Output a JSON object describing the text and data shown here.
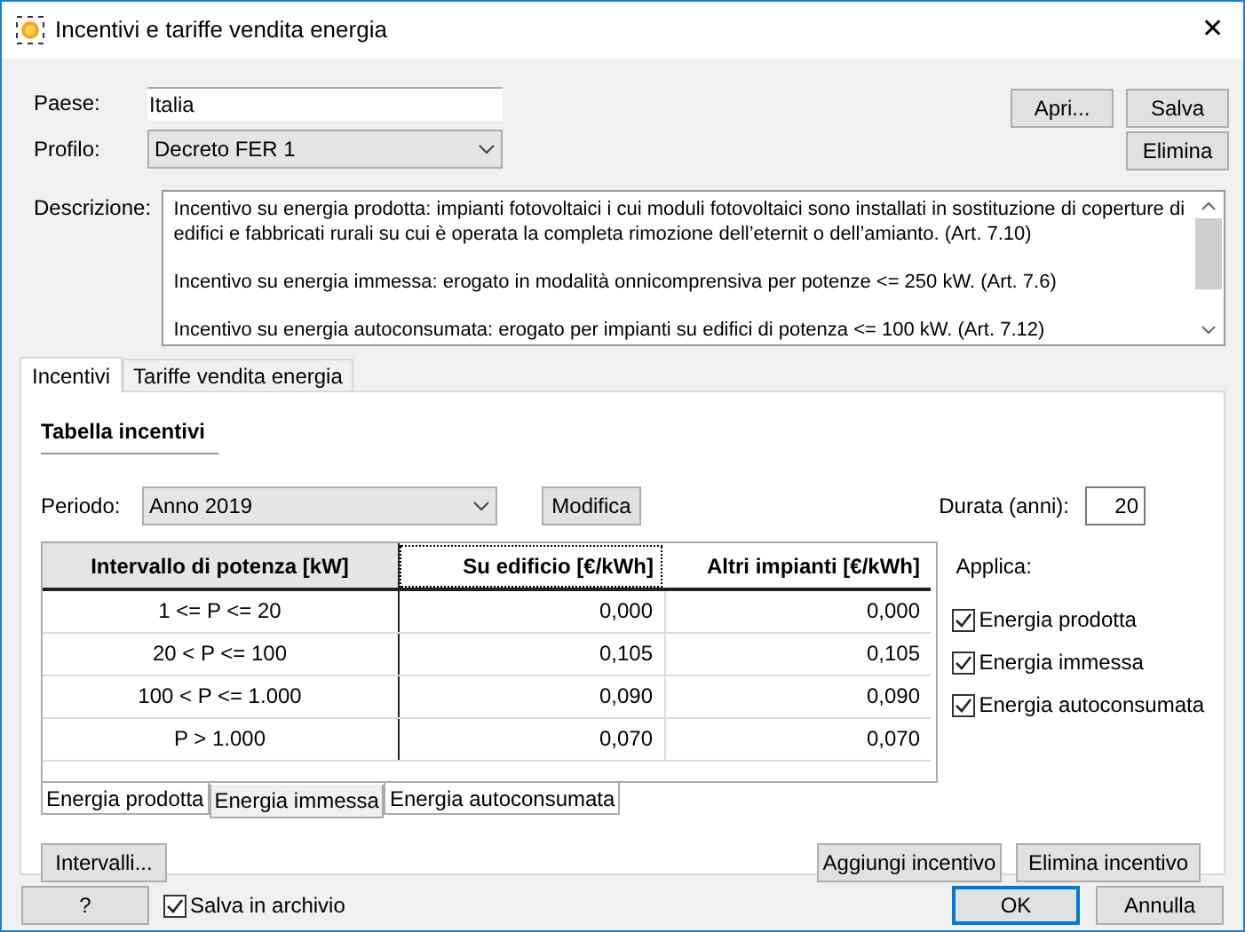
{
  "window": {
    "title": "Incentivi e tariffe vendita energia",
    "close": "✕"
  },
  "paese": {
    "label": "Paese:",
    "value": "Italia"
  },
  "profilo": {
    "label": "Profilo:",
    "value": "Decreto FER 1"
  },
  "header_buttons": [
    "Apri...",
    "Salva",
    "Elimina"
  ],
  "descrizione": {
    "label": "Descrizione:",
    "paragraphs": [
      "Incentivo su energia prodotta: impianti fotovoltaici i cui moduli fotovoltaici sono installati in sostituzione di coperture di edifici e fabbricati rurali su cui è operata la completa rimozione dell’eternit o dell’amianto. (Art. 7.10)",
      "Incentivo su energia immessa: erogato in modalità onnicomprensiva per potenze <= 250 kW. (Art. 7.6)",
      "Incentivo su energia autoconsumata: erogato per impianti su edifici di potenza <= 100 kW. (Art. 7.12)"
    ]
  },
  "tabs": [
    {
      "label": "Incentivi",
      "selected": true
    },
    {
      "label": "Tariffe vendita energia",
      "selected": false
    }
  ],
  "incentivi": {
    "section_title": "Tabella incentivi",
    "periodo": {
      "label": "Periodo:",
      "value": "Anno 2019"
    },
    "modifica_button": "Modifica",
    "durata": {
      "label": "Durata (anni):",
      "value": "20"
    },
    "table": {
      "columns": [
        {
          "label": "Intervallo di potenza [kW]",
          "focused": false
        },
        {
          "label": "Su edificio [€/kWh]",
          "focused": true
        },
        {
          "label": "Altri impianti [€/kWh]",
          "focused": false
        }
      ],
      "rows": [
        [
          "1 <= P <= 20",
          "0,000",
          "0,000"
        ],
        [
          "20 < P <= 100",
          "0,105",
          "0,105"
        ],
        [
          "100 < P <= 1.000",
          "0,090",
          "0,090"
        ],
        [
          "P > 1.000",
          "0,070",
          "0,070"
        ]
      ]
    },
    "sheet_tabs": [
      {
        "label": "Energia prodotta",
        "selected": false
      },
      {
        "label": "Energia immessa",
        "selected": true
      },
      {
        "label": "Energia autoconsumata",
        "selected": false
      }
    ],
    "applica": {
      "label": "Applica:",
      "options": [
        {
          "label": "Energia prodotta",
          "checked": true
        },
        {
          "label": "Energia immessa",
          "checked": true
        },
        {
          "label": "Energia autoconsumata",
          "checked": true
        }
      ]
    },
    "intervalli_button": "Intervalli...",
    "action_buttons": [
      "Aggiungi incentivo",
      "Elimina incentivo"
    ]
  },
  "footer": {
    "help_button": "?",
    "archive": {
      "label": "Salva in archivio",
      "checked": true
    },
    "buttons": [
      {
        "label": "OK",
        "default": true
      },
      {
        "label": "Annulla",
        "default": false
      }
    ]
  }
}
